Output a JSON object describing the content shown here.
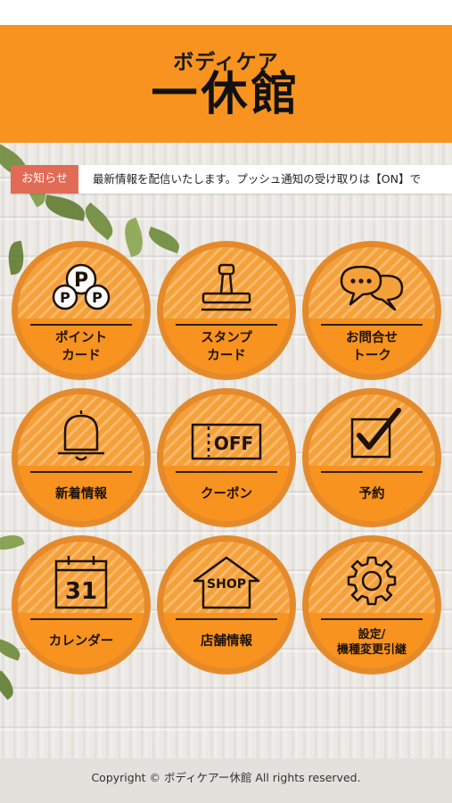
{
  "header": {
    "brand_sub": "ボディケア",
    "brand_main": "一休館"
  },
  "news": {
    "label": "お知らせ",
    "text": "最新情報を配信いたします。プッシュ通知の受け取りは【ON】で"
  },
  "menu": [
    {
      "line1": "ポイント",
      "line2": "カード",
      "icon": "point-card-icon"
    },
    {
      "line1": "スタンプ",
      "line2": "カード",
      "icon": "stamp-icon"
    },
    {
      "line1": "お問合せ",
      "line2": "トーク",
      "icon": "chat-bubbles-icon"
    },
    {
      "line1": "新着情報",
      "line2": "",
      "icon": "bell-icon"
    },
    {
      "line1": "クーポン",
      "line2": "",
      "icon": "coupon-icon",
      "icon_text": "OFF"
    },
    {
      "line1": "予約",
      "line2": "",
      "icon": "checkbox-icon"
    },
    {
      "line1": "カレンダー",
      "line2": "",
      "icon": "calendar-icon",
      "icon_text": "31"
    },
    {
      "line1": "店舗情報",
      "line2": "",
      "icon": "shop-icon",
      "icon_text": "SHOP"
    },
    {
      "line1": "設定/",
      "line2": "機種変更引継",
      "icon": "gear-icon"
    }
  ],
  "footer": {
    "copyright": "Copyright © ボディケアー休館 All rights reserved."
  },
  "colors": {
    "header_orange": "#f7931e",
    "button_orange": "#f5a13a",
    "news_label_red": "#e26b56"
  }
}
